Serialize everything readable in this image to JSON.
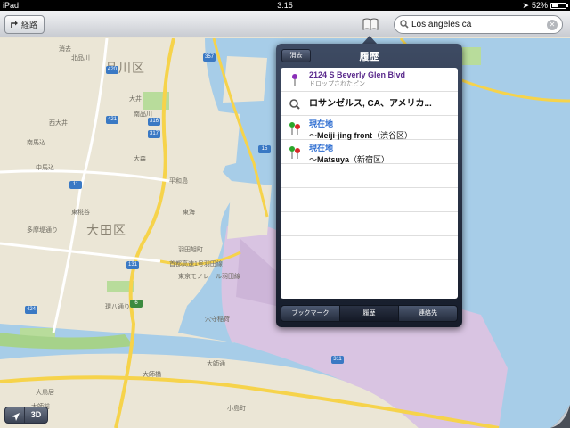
{
  "status_bar": {
    "device": "iPad",
    "time": "3:15",
    "battery": "52%",
    "battery_level": 0.52
  },
  "toolbar": {
    "route_label": "経路",
    "search_value": "Los angeles ca"
  },
  "popover": {
    "title": "履歴",
    "clear_label": "消去",
    "items": [
      {
        "type": "pin",
        "title": "2124 S Beverly Glen Blvd",
        "subtitle": "ドロップされたピン"
      },
      {
        "type": "search",
        "title": "ロサンゼルス, CA、アメリカ..."
      },
      {
        "type": "route",
        "title": "現在地",
        "place": "Meiji-jing front",
        "area": "（渋谷区）"
      },
      {
        "type": "route",
        "title": "現在地",
        "place": "Matsuya",
        "area": "（新宿区）"
      }
    ],
    "tabs": [
      {
        "label": "ブックマーク",
        "active": false
      },
      {
        "label": "履歴",
        "active": true
      },
      {
        "label": "連絡先",
        "active": false
      }
    ]
  },
  "map": {
    "three_d_label": "3D",
    "districts": [
      "品川区",
      "大田区"
    ],
    "labels": [
      "消去",
      "北品川",
      "大井",
      "西大井",
      "南品川",
      "南馬込",
      "中馬込",
      "大森",
      "平和島",
      "東海",
      "東糀谷",
      "羽田旭町",
      "多摩堤通り",
      "環八通り",
      "大師橋",
      "大鳥居",
      "穴守稲荷",
      "大師通",
      "大師前",
      "小島町",
      "東京モノレール羽田線",
      "首都高速1号羽田線"
    ],
    "route_numbers": [
      "357",
      "420",
      "421",
      "316",
      "317",
      "15",
      "11",
      "131",
      "6",
      "424",
      "311"
    ]
  }
}
